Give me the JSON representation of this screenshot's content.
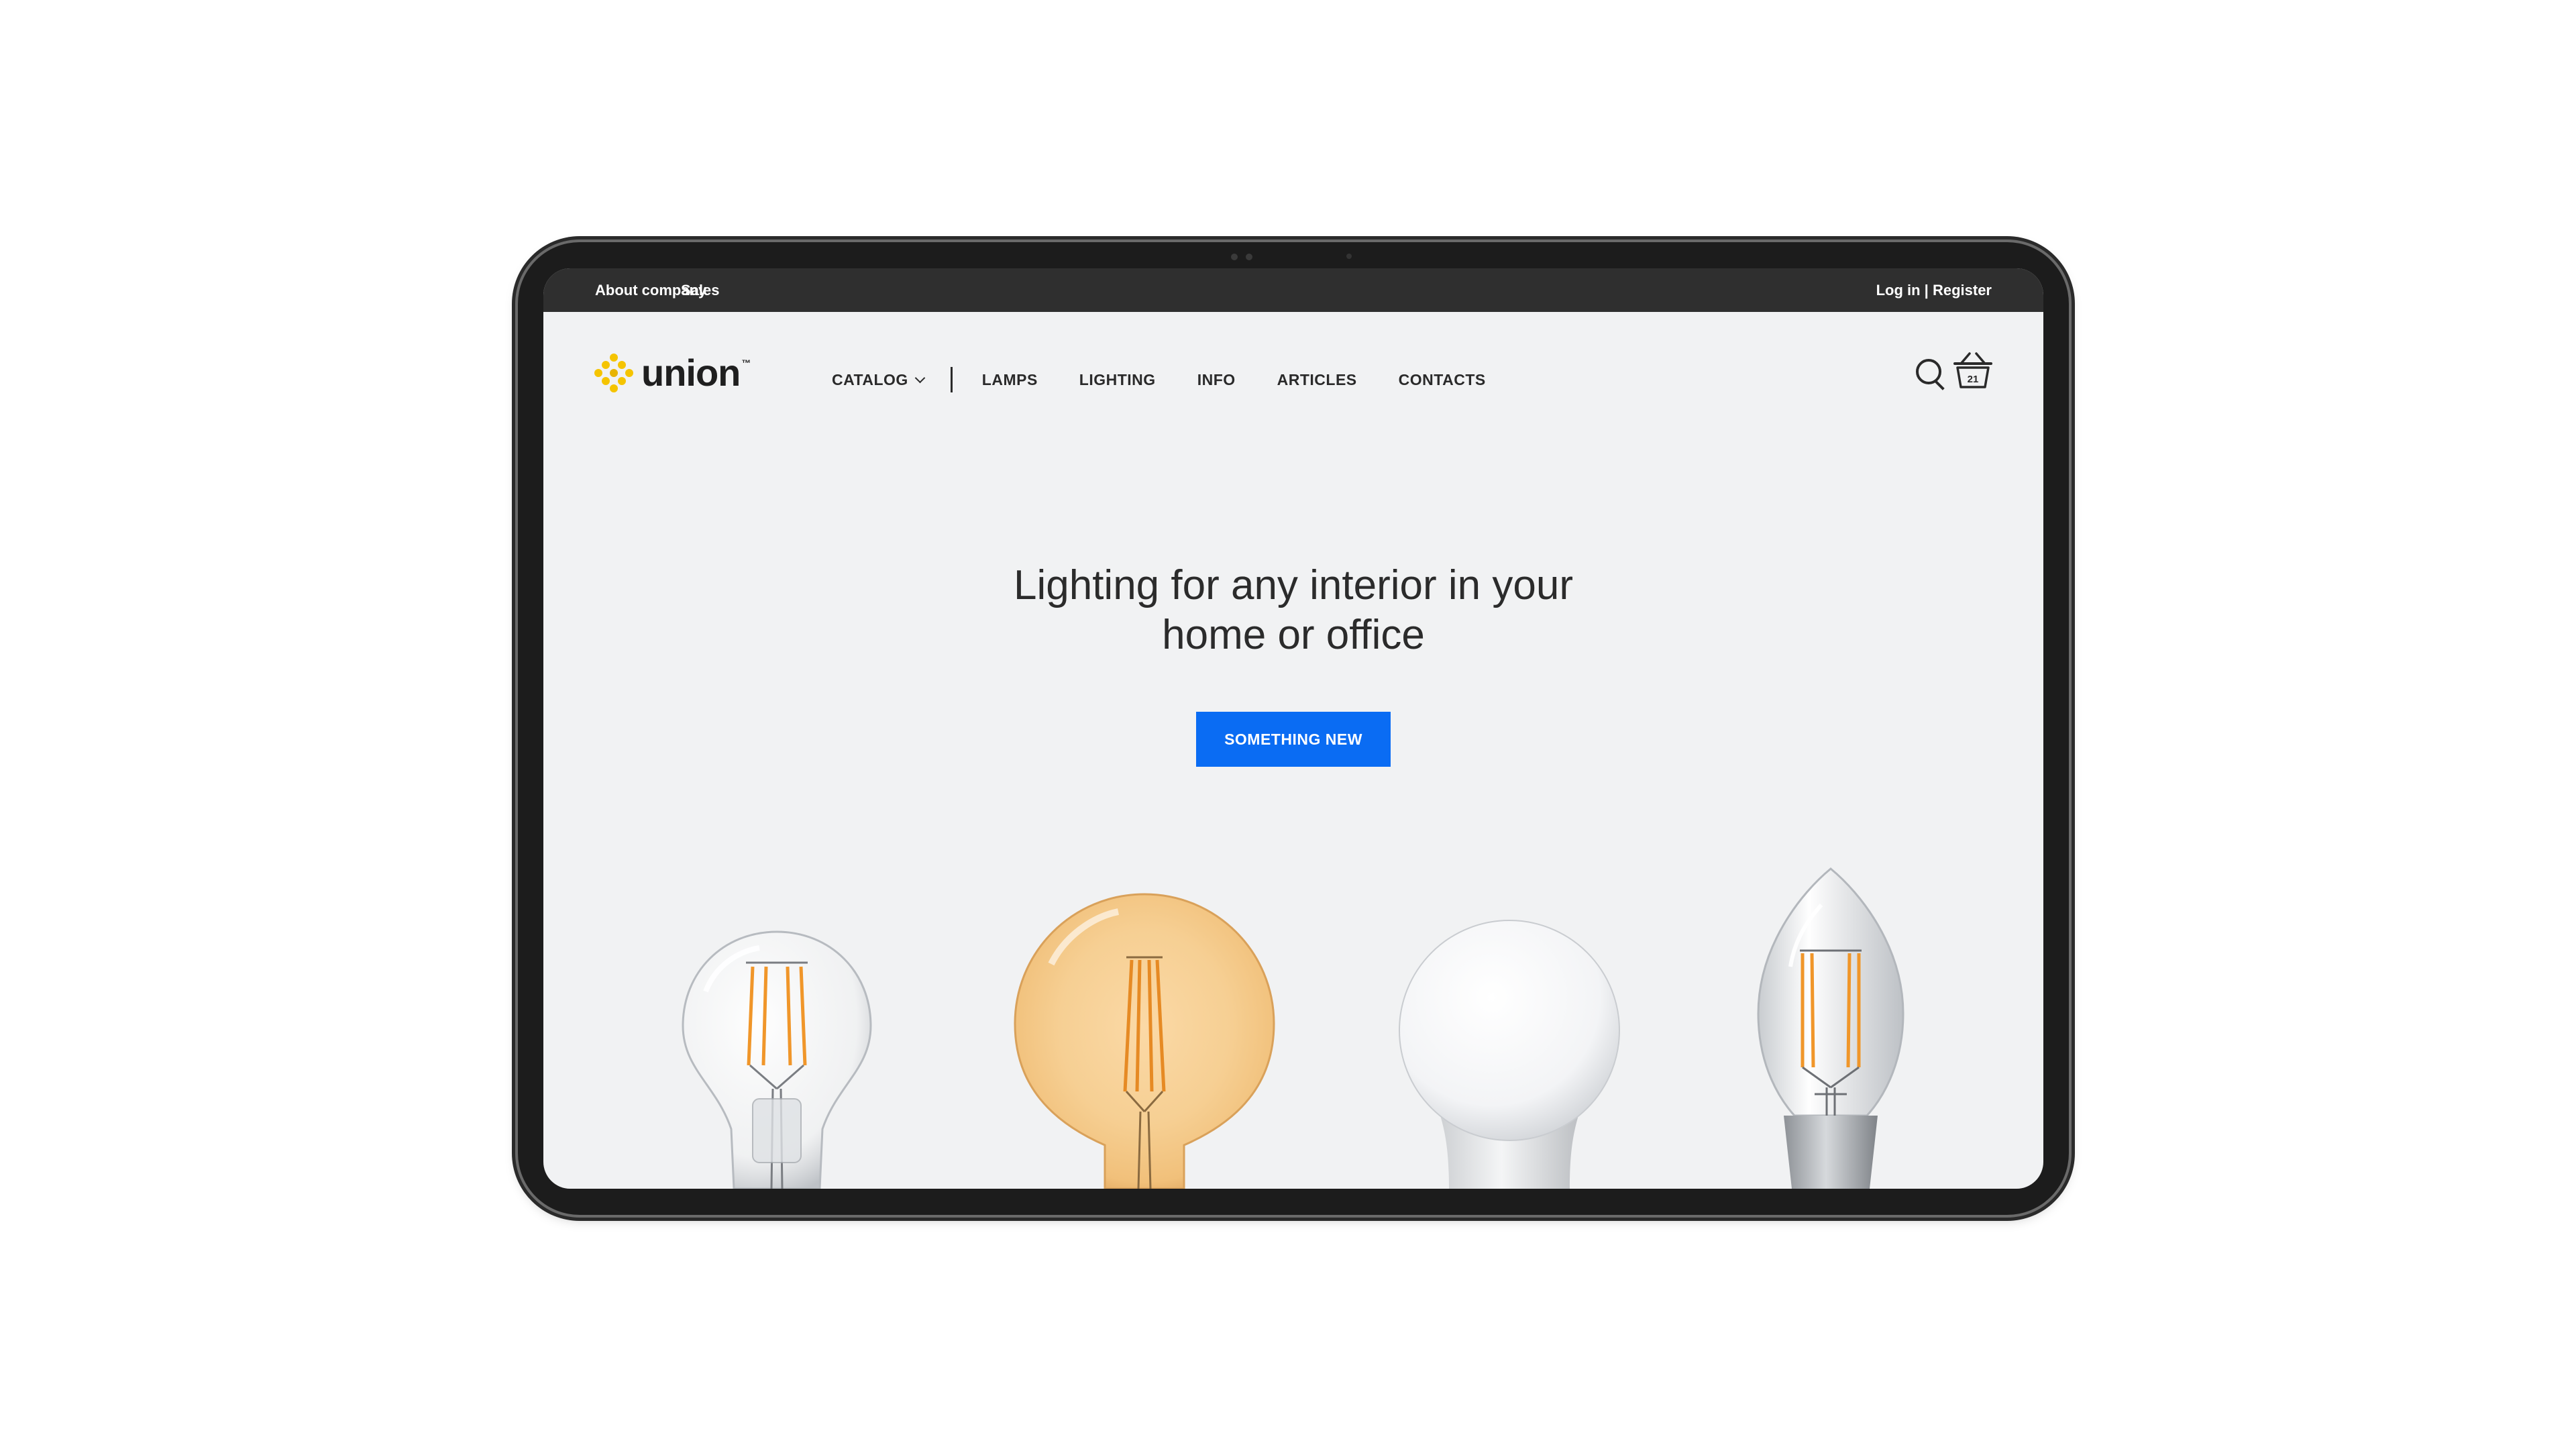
{
  "topbar": {
    "about": "About company",
    "sales": "Sales",
    "login": "Log in",
    "separator": " | ",
    "register": "Register"
  },
  "header": {
    "logo_text": "union",
    "logo_tm": "™",
    "nav": {
      "catalog": "CATALOG",
      "lamps": "LAMPS",
      "lighting": "LIGHTING",
      "info": "INFO",
      "articles": "ARTICLES",
      "contacts": "CONTACTS"
    },
    "cart_count": "21",
    "icons": [
      "search-icon",
      "basket-icon",
      "chevron-down-icon"
    ]
  },
  "hero": {
    "title_line1": "Lighting for any interior in your",
    "title_line2": "home or office",
    "cta_label": "SOMETHING NEW"
  },
  "products": [
    "clear-filament-bulb",
    "amber-globe-bulb",
    "frosted-led-bulb",
    "candle-filament-bulb"
  ],
  "colors": {
    "topbar_bg": "#2f2f2f",
    "page_bg": "#f1f2f3",
    "accent": "#0a6cf3",
    "logo_yellow": "#f5c400",
    "filament": "#f0962a"
  }
}
